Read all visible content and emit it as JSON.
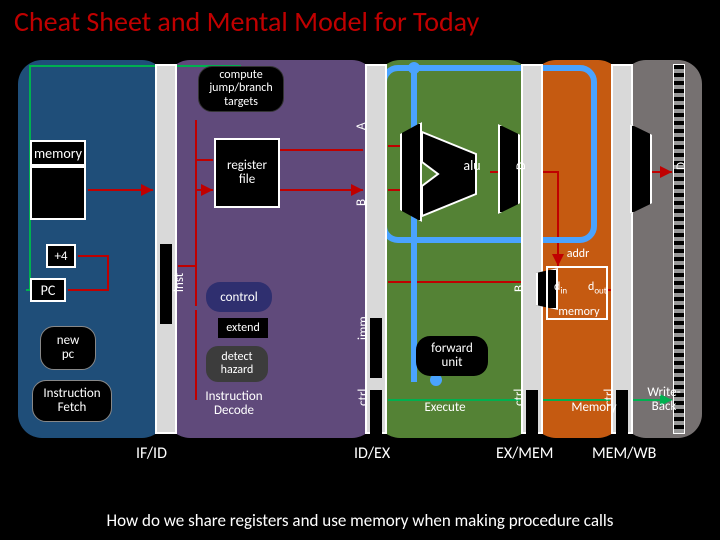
{
  "title": "Cheat Sheet and Mental Model for Today",
  "bottom": "How do we share registers and use memory when making procedure calls",
  "if": {
    "memory": "memory",
    "plus4": "+4",
    "pc": "PC",
    "newpc": "new\npc",
    "fetch": "Instruction\nFetch"
  },
  "id": {
    "compute": "compute\njump/branch\ntargets",
    "regfile": "register\nfile",
    "control": "control",
    "extend": "extend",
    "detect": "detect\nhazard",
    "decode": "Instruction\nDecode"
  },
  "ex": {
    "alu": "alu",
    "forward": "forward\nunit",
    "execute": "Execute"
  },
  "mem": {
    "addr": "addr",
    "din": "d",
    "din_sub": "in",
    "dout": "d",
    "dout_sub": "out",
    "memory": "memory",
    "stage": "Memory"
  },
  "wb": {
    "stage": "Write-\nBack"
  },
  "regs": {
    "ifid": "IF/ID",
    "idex": "ID/EX",
    "exmem": "EX/MEM",
    "memwb": "MEM/WB"
  },
  "ports": {
    "inst": "inst",
    "A": "A",
    "B": "B",
    "Bm": "B",
    "imm": "imm",
    "ctrl": "ctrl",
    "D": "D"
  }
}
